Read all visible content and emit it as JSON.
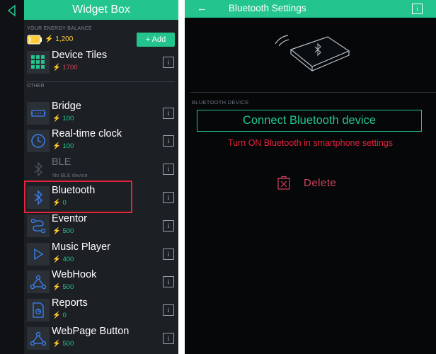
{
  "widget_box": {
    "title": "Widget Box",
    "balance_label": "YOUR ENERGY BALANCE",
    "balance_value": "⚡ 1,200",
    "add_label": "+ Add",
    "section_other": "OTHER",
    "items": [
      {
        "name": "Device Tiles",
        "price": "⚡ 1700",
        "info": "i"
      },
      {
        "name": "Bridge",
        "price": "⚡ 100",
        "info": "i"
      },
      {
        "name": "Real-time clock",
        "price": "⚡ 100",
        "info": "i"
      },
      {
        "name": "BLE",
        "price": "No BLE device",
        "info": "i"
      },
      {
        "name": "Bluetooth",
        "price": "⚡ 0",
        "info": "i"
      },
      {
        "name": "Eventor",
        "price": "⚡ 500",
        "info": "i"
      },
      {
        "name": "Music Player",
        "price": "⚡ 400",
        "info": "i"
      },
      {
        "name": "WebHook",
        "price": "⚡ 500",
        "info": "i"
      },
      {
        "name": "Reports",
        "price": "⚡ 0",
        "info": "i"
      },
      {
        "name": "WebPage Button",
        "price": "⚡ 500",
        "info": "i"
      }
    ]
  },
  "bluetooth_settings": {
    "back": "←",
    "title": "Bluetooth Settings",
    "info": "i",
    "section_label": "BLUETOOTH DEVICE",
    "connect_label": "Connect Bluetooth device",
    "warning": "Turn ON Bluetooth in smartphone settings",
    "delete_label": "Delete"
  },
  "colors": {
    "accent": "#23c48e",
    "panel_bg": "#1c1f24",
    "settings_bg": "#050709",
    "warning": "#e5233a",
    "energy": "#ffcc3a",
    "highlight_box": "#e5233a"
  }
}
